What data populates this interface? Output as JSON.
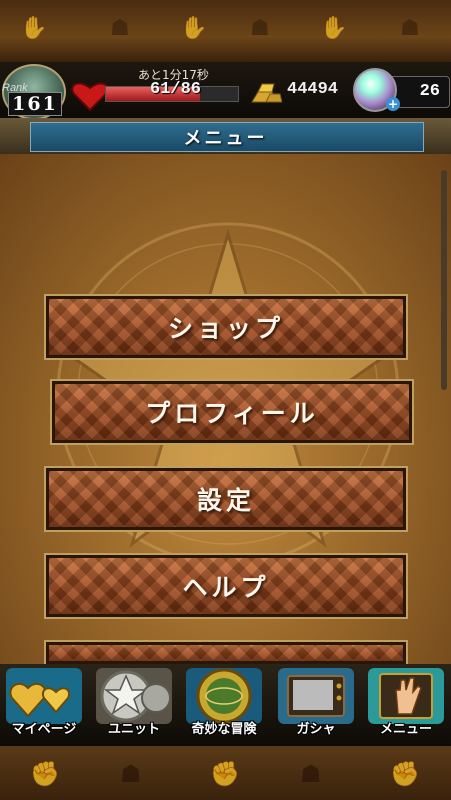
{
  "status": {
    "rank_label": "Rank",
    "rank": "161",
    "timer": "あと1分17秒",
    "hp_text": "61/86",
    "hp_fraction": 0.71,
    "gold": "44494",
    "gems": "26",
    "gem_plus": "+"
  },
  "header": {
    "title": "メニュー"
  },
  "menu": {
    "items": [
      "ショップ",
      "プロフィール",
      "設定",
      "ヘルプ"
    ]
  },
  "nav": {
    "items": [
      {
        "label": "マイページ",
        "icon": "heart-icon"
      },
      {
        "label": "ユニット",
        "icon": "star-icon"
      },
      {
        "label": "奇妙な冒険",
        "icon": "globe-icon"
      },
      {
        "label": "ガシャ",
        "icon": "tv-icon"
      },
      {
        "label": "メニュー",
        "icon": "hand-icon"
      }
    ]
  },
  "colors": {
    "accent": "#2f6d8e",
    "button": "#a44e22",
    "hp": "#c82828"
  }
}
